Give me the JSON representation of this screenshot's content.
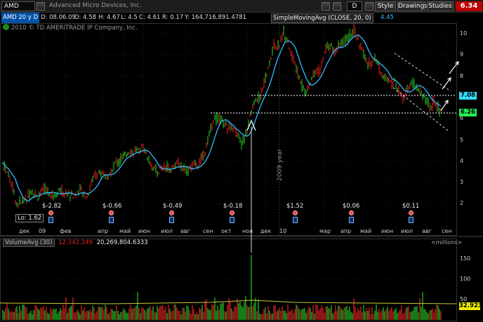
{
  "toolbar": {
    "symbol": "AMD",
    "company": "Advanced Micro Devices, Inc.",
    "period": "D",
    "style_label": "Style",
    "drawings_label": "Drawings",
    "studies_label": "Studies",
    "last_price": "6.34"
  },
  "infobar": {
    "symbol_period": "AMD 20 y D",
    "date": "D: 08.06.09",
    "open": "O: 4.58",
    "high": "H: 4.67",
    "low": "L: 4.5",
    "close": "C: 4.61",
    "range": "R: 0.17",
    "volume": "Y: 164,716,891.4781",
    "study": "SimpleMovingAvg (CLOSE, 20, 0)",
    "study_value": "4.45"
  },
  "copyright": "2010 © TD AMERITRADE IP Company, Inc.",
  "price_axis": [
    "10",
    "9",
    "8",
    "7",
    "6",
    "5",
    "4",
    "3",
    "2"
  ],
  "date_axis": [
    "дек",
    "09",
    "фев",
    "апр",
    "май",
    "июн",
    "июл",
    "авг",
    "сен",
    "окт",
    "ноя",
    "дек",
    "10",
    "мар",
    "апр",
    "май",
    "июн",
    "июл",
    "авг",
    "сен"
  ],
  "year_label": "2009 year",
  "lo_label": "Lo: 1.62",
  "price_labels": {
    "resistance": "7.08",
    "support": "6.26",
    "resistance_color": "#33ddff",
    "support_color": "#22ee55"
  },
  "earnings": [
    "$-2.82",
    "$-0.66",
    "$-0.49",
    "$-0.18",
    "$1.52",
    "$0.06",
    "$0.11"
  ],
  "volume": {
    "study_name": "VolumeAvg (30)",
    "avg_value": "12,342,349",
    "current_value": "20,269,804.6333",
    "units": "<millions>",
    "axis": [
      "150",
      "100",
      "50"
    ],
    "last_value": "32.923"
  },
  "colors": {
    "up": "#22cc22",
    "down": "#dd2222",
    "ma": "#33bbff",
    "avg_line": "#cccc33",
    "last_price_bg": "#bb0000"
  }
}
